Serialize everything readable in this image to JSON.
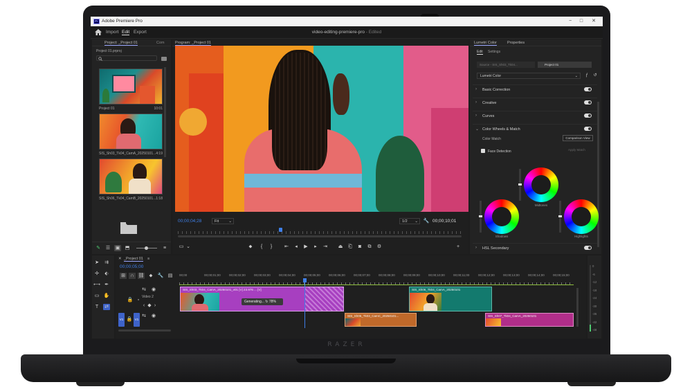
{
  "device": {
    "brand": "RAZER"
  },
  "titlebar": {
    "app_title": "Adobe Premiere Pro",
    "logo_text": "Pr"
  },
  "menubar": {
    "items": [
      "Import",
      "Edit",
      "Export"
    ],
    "active": "Edit",
    "doc_title": "video-editing-premiere-pro",
    "doc_status": "- Edited"
  },
  "project_panel": {
    "tabs": [
      "Project: _Project 01",
      "Com"
    ],
    "project_name": "Project 01.prproj",
    "clips": [
      {
        "name": "Project 01",
        "duration": "10:01"
      },
      {
        "name": "SIS_Sh03_Tk04_CamA_20250101...",
        "duration": "4:19"
      },
      {
        "name": "SIS_Sh06_Tk04_CamB_20250101...",
        "duration": "1:18"
      }
    ]
  },
  "program_monitor": {
    "tab": "Program: _Project 01",
    "timecode_current": "00;00;04;28",
    "fit": "Fit",
    "resolution": "1/2",
    "timecode_total": "00;00;10;01"
  },
  "lumetri": {
    "tabs": [
      "Lumetri Color",
      "Properties"
    ],
    "subtabs": [
      "Edit",
      "Settings"
    ],
    "source_label": "Source - SIS_Sh03_Tk04...",
    "target_label": "Project 01",
    "preset": "Lumetri Color",
    "sections": [
      "Basic Correction",
      "Creative",
      "Curves",
      "Color Wheels & Match",
      "HSL Secondary"
    ],
    "color_match_label": "Color Match",
    "comparison_view": "Comparison View",
    "face_detection": "Face Detection",
    "apply_match": "Apply Match",
    "wheels": [
      "Midtones",
      "Shadows",
      "Highlights"
    ]
  },
  "timeline": {
    "tab": "_Project 01",
    "timecode": "00;00;05;00",
    "ruler": [
      "00;00",
      "00;00;01;00",
      "00;00;02;00",
      "00;00;03;00",
      "00;00;04;00",
      "00;00;05;00",
      "00;00;06;00",
      "00;00;07;00",
      "00;00;08;00",
      "00;00;09;00",
      "00;00;10;00",
      "00;00;11;00",
      "00;00;12;00",
      "00;00;13;00",
      "00;00;14;00",
      "00;00;15;00"
    ],
    "video_track_label": "Video 2",
    "track_buttons": [
      "V1",
      "V1"
    ],
    "clips": {
      "v2_a": "SIS_Sh03_Tk04_CamA_20250101_v01 [V] 23.976 ... [V]",
      "v2_b": "SIS_Sh06_Tk04_CamA_20250101",
      "v1_a": "SIS_Sh05_Tk03_CamC_20250101...",
      "v1_b": "SIS_Sh07_Tk04_CamA_20250101"
    },
    "generating": {
      "label": "Generating...",
      "percent": "78%"
    },
    "meter_scale": [
      "0",
      "-6",
      "-12",
      "-18",
      "-24",
      "-30",
      "-36",
      "-42",
      "-48"
    ]
  }
}
